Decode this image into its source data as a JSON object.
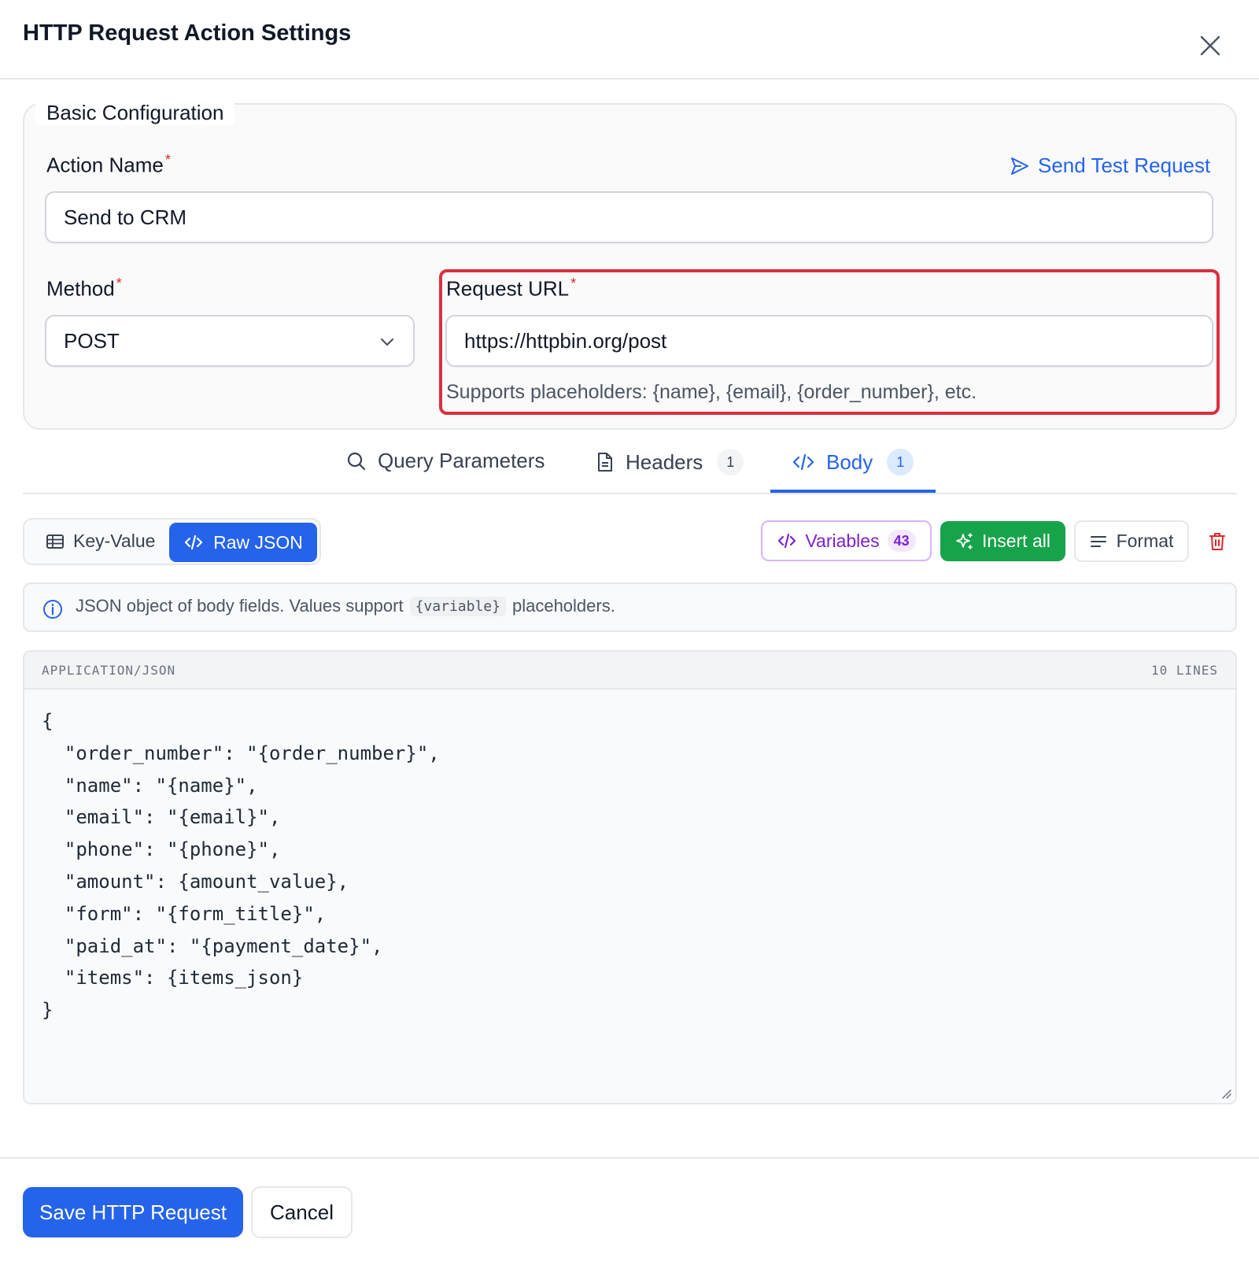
{
  "dialog": {
    "title": "HTTP Request Action Settings"
  },
  "basic_config": {
    "legend": "Basic Configuration",
    "action_name": {
      "label": "Action Name",
      "required_mark": "*",
      "value": "Send to CRM"
    },
    "send_test_label": "Send Test Request",
    "method": {
      "label": "Method",
      "required_mark": "*",
      "value": "POST"
    },
    "request_url": {
      "label": "Request URL",
      "required_mark": "*",
      "value": "https://httpbin.org/post",
      "hint": "Supports placeholders: {name}, {email}, {order_number}, etc."
    }
  },
  "tabs": {
    "query": {
      "label": "Query Parameters"
    },
    "headers": {
      "label": "Headers",
      "count": "1"
    },
    "body": {
      "label": "Body",
      "count": "1"
    },
    "active": "body"
  },
  "body_toolbar": {
    "mode_kv_label": "Key-Value",
    "mode_raw_label": "Raw JSON",
    "active_mode": "raw",
    "variables_label": "Variables",
    "variables_count": "43",
    "insert_all_label": "Insert all",
    "format_label": "Format"
  },
  "info": {
    "text_before": "JSON object of body fields. Values support",
    "code": "{variable}",
    "text_after": "placeholders."
  },
  "editor": {
    "mime": "APPLICATION/JSON",
    "line_count_label": "10 LINES",
    "lines": [
      "{",
      "  \"order_number\": \"{order_number}\",",
      "  \"name\": \"{name}\",",
      "  \"email\": \"{email}\",",
      "  \"phone\": \"{phone}\",",
      "  \"amount\": {amount_value},",
      "  \"form\": \"{form_title}\",",
      "  \"paid_at\": \"{payment_date}\",",
      "  \"items\": {items_json}",
      "}"
    ]
  },
  "footer": {
    "save_label": "Save HTTP Request",
    "cancel_label": "Cancel"
  },
  "colors": {
    "primary": "#2563eb",
    "success": "#16a34a",
    "danger": "#dc2626",
    "purple": "#7e22ce",
    "highlight_border": "#dc2f3e"
  },
  "icons": {
    "close": "close-icon",
    "send": "send-icon",
    "chevron": "chevron-down-icon",
    "search": "search-icon",
    "document": "document-icon",
    "code": "code-icon",
    "table": "table-icon",
    "sparkle": "sparkle-icon",
    "align": "align-left-icon",
    "trash": "trash-icon",
    "info": "info-icon"
  }
}
